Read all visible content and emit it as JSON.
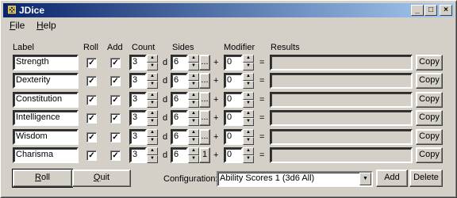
{
  "window": {
    "title": "JDice",
    "controls": {
      "minimize": "_",
      "maximize": "□",
      "close": "×"
    }
  },
  "menu": [
    {
      "label": "File",
      "mnemonic": "F",
      "rest": "ile"
    },
    {
      "label": "Help",
      "mnemonic": "H",
      "rest": "elp"
    }
  ],
  "headers": {
    "label": "Label",
    "roll": "Roll",
    "add": "Add",
    "count": "Count",
    "sides": "Sides",
    "modifier": "Modifier",
    "results": "Results"
  },
  "separators": {
    "d": "d",
    "plus": "+",
    "equals": "="
  },
  "rows": [
    {
      "label": "Strength",
      "roll": true,
      "add": true,
      "count": "3",
      "sides": "6",
      "sides_button": "...",
      "modifier": "0",
      "result": "",
      "copy": "Copy"
    },
    {
      "label": "Dexterity",
      "roll": true,
      "add": true,
      "count": "3",
      "sides": "6",
      "sides_button": "...",
      "modifier": "0",
      "result": "",
      "copy": "Copy"
    },
    {
      "label": "Constitution",
      "roll": true,
      "add": true,
      "count": "3",
      "sides": "6",
      "sides_button": "...",
      "modifier": "0",
      "result": "",
      "copy": "Copy"
    },
    {
      "label": "Intelligence",
      "roll": true,
      "add": true,
      "count": "3",
      "sides": "6",
      "sides_button": "...",
      "modifier": "0",
      "result": "",
      "copy": "Copy"
    },
    {
      "label": "Wisdom",
      "roll": true,
      "add": true,
      "count": "3",
      "sides": "6",
      "sides_button": "...",
      "modifier": "0",
      "result": "",
      "copy": "Copy"
    },
    {
      "label": "Charisma",
      "roll": true,
      "add": true,
      "count": "3",
      "sides": "6",
      "sides_button": "1",
      "modifier": "0",
      "result": "",
      "copy": "Copy"
    }
  ],
  "footer": {
    "roll": {
      "label": "Roll",
      "mnemonic": "R",
      "rest": "oll"
    },
    "quit": {
      "label": "Quit",
      "mnemonic": "Q",
      "rest": "uit"
    },
    "config_label": "Configuration:",
    "config_value": "Ability Scores 1 (3d6 All)",
    "add": "Add",
    "delete": "Delete"
  },
  "icons": {
    "app": "dice-icon",
    "spin_up": "▲",
    "spin_down": "▼",
    "check": "✓",
    "dropdown": "▼"
  }
}
